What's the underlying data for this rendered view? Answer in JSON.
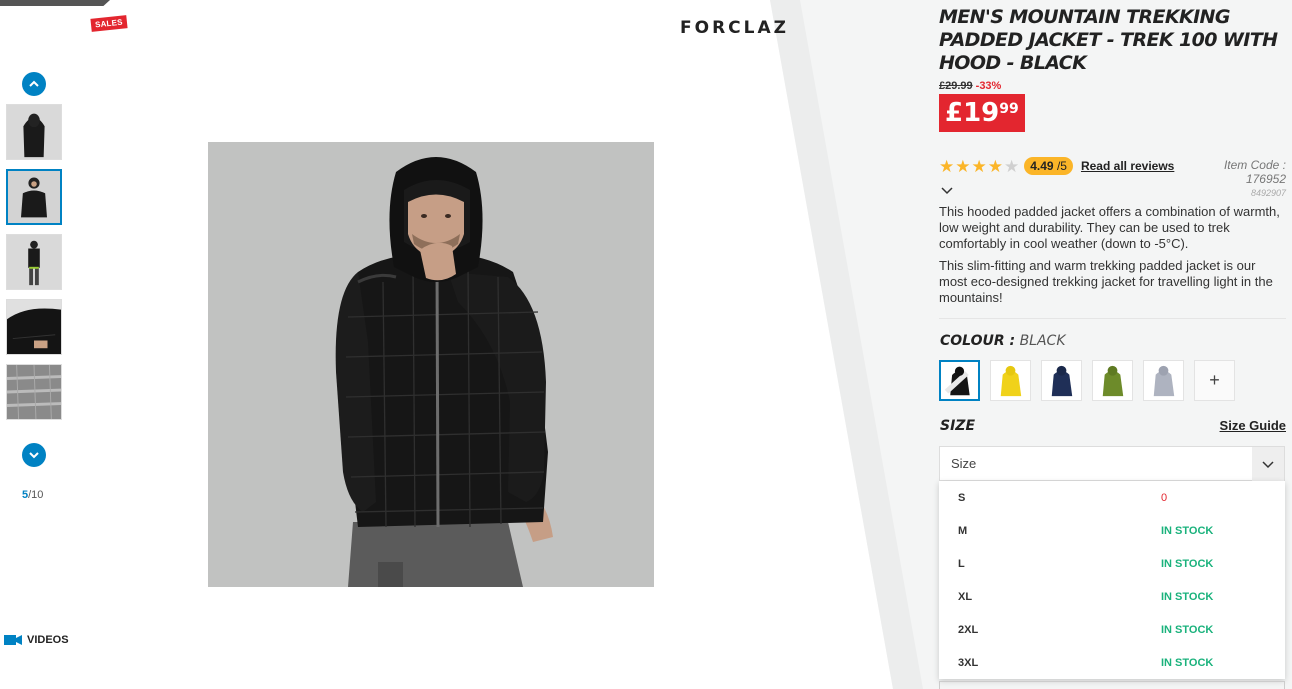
{
  "header": {
    "brand": "FORCLAZ",
    "sales_badge": "SALES"
  },
  "gallery": {
    "counter_current": "5",
    "counter_total": "/10",
    "videos_label": "VIDEOS",
    "thumbnails": [
      "thumb-1",
      "thumb-2",
      "thumb-3",
      "thumb-4",
      "thumb-5"
    ],
    "selected_thumbnail_index": 1
  },
  "product": {
    "title": "MEN'S MOUNTAIN TREKKING PADDED JACKET - TREK 100 WITH HOOD - BLACK",
    "old_price": "£29.99",
    "discount": "-33%",
    "price_int": "£19",
    "price_dec": "99",
    "rating_stars": 4.49,
    "rating_value": "4.49",
    "rating_denominator": "/5",
    "read_reviews_label": "Read all reviews",
    "item_code_label": "Item Code :",
    "item_code": "176952",
    "item_subcode": "8492907",
    "description": [
      "This hooded padded jacket offers a combination of warmth, low weight and durability. They can be used to trek comfortably in cool weather (down to -5°C).",
      "This slim-fitting and warm trekking padded jacket is our most eco-designed trekking jacket for travelling light in the mountains!"
    ]
  },
  "colour": {
    "label": "COLOUR :",
    "value": "BLACK",
    "swatches": [
      "black",
      "yellow",
      "navy",
      "khaki",
      "grey"
    ],
    "more_label": "+"
  },
  "size": {
    "label": "SIZE",
    "guide_label": "Size Guide",
    "placeholder": "Size",
    "options": [
      {
        "name": "S",
        "status": "0"
      },
      {
        "name": "M",
        "status": "IN STOCK"
      },
      {
        "name": "L",
        "status": "IN STOCK"
      },
      {
        "name": "XL",
        "status": "IN STOCK"
      },
      {
        "name": "2XL",
        "status": "IN STOCK"
      },
      {
        "name": "3XL",
        "status": "IN STOCK"
      }
    ]
  },
  "colors": {
    "accent": "#0082c3",
    "sale": "#e3262f",
    "stock": "#1ab27c",
    "rating": "#fbb528"
  }
}
